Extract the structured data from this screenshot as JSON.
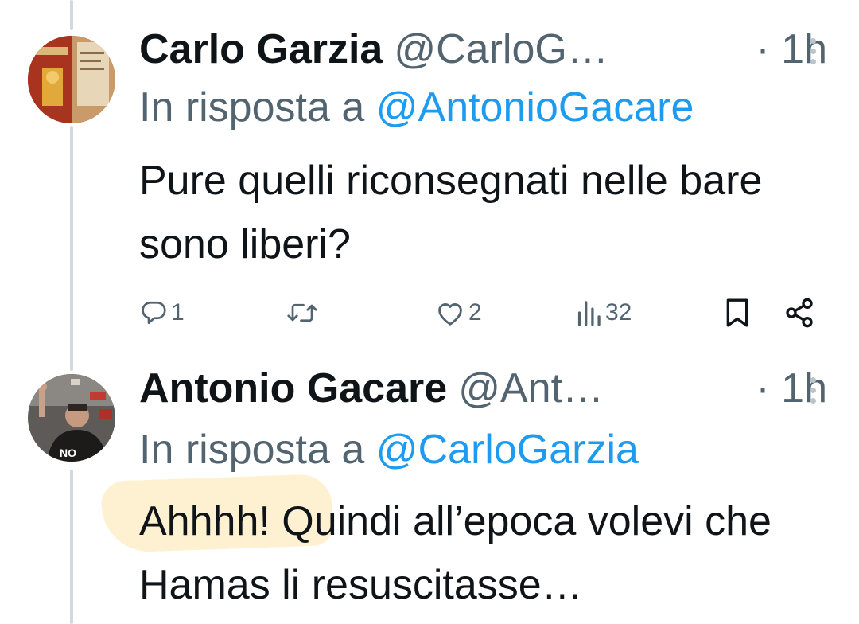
{
  "tweets": [
    {
      "name": "Carlo Garzia",
      "handle": "@CarloG…",
      "time": "· 1h",
      "reply_prefix": "In risposta a ",
      "reply_to": "@AntonioGacare",
      "text": "Pure quelli riconsegnati nelle bare sono liberi?",
      "replies": "1",
      "likes": "2",
      "views": "32"
    },
    {
      "name": "Antonio Gacare",
      "handle": "@Ant…",
      "time": "· 1h",
      "reply_prefix": "In risposta a ",
      "reply_to": "@CarloGarzia",
      "text": "Ahhhh! Quindi all’epoca volevi che Hamas li resuscitasse…",
      "avatar_sign": "NO"
    }
  ],
  "icons": [
    "reply-icon",
    "retweet-icon",
    "like-icon",
    "views-icon",
    "bookmark-icon",
    "share-icon",
    "more-icon"
  ],
  "colors": {
    "accent": "#1d9bf0",
    "secondary_text": "#536471",
    "highlight": "#fdf0cc"
  }
}
